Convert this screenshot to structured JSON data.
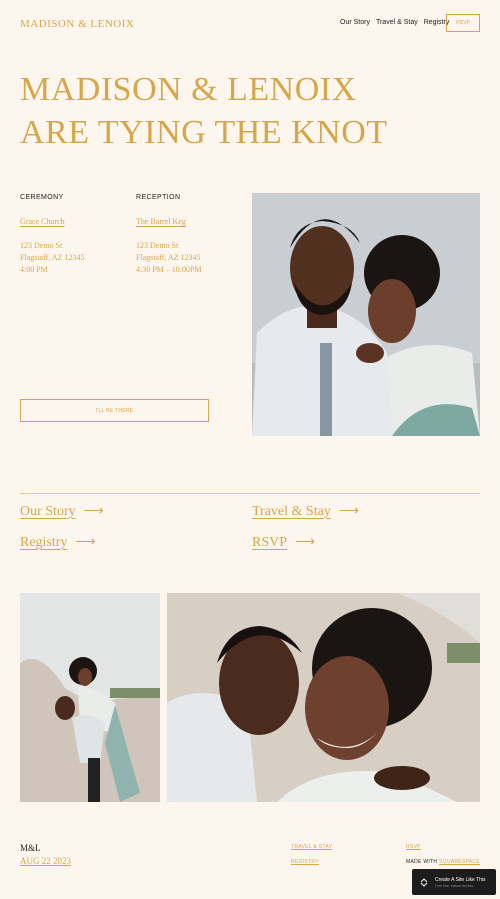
{
  "header": {
    "brand": "MADISON & LENOIX",
    "nav": [
      "Our Story",
      "Travel & Stay",
      "Registry"
    ],
    "rsvp_button": "RSVP"
  },
  "hero": {
    "line1": "MADISON & LENOIX",
    "line2": "ARE TYING THE KNOT"
  },
  "ceremony": {
    "label": "CEREMONY",
    "venue": "Grace Church",
    "address1": "123 Demo St",
    "address2": "Flagstaff, AZ 12345",
    "time": "4:00 PM"
  },
  "reception": {
    "label": "RECEPTION",
    "venue": "The Barrel Keg",
    "address1": "123 Demo St",
    "address2": "Flagstaff, AZ 12345",
    "time": "4:30 PM – 10:00PM"
  },
  "attend_button": "I'LL BE THERE",
  "links": [
    "Our Story",
    "Travel & Stay",
    "Registry",
    "RSVP"
  ],
  "arrow": "⟶",
  "footer": {
    "initials": "M&L",
    "date": "AUG 22 2023",
    "travel": "TRAVEL & STAY",
    "registry": "REGISTRY",
    "rsvp": "RSVP",
    "made_with": "MADE WITH",
    "squarespace": "SQUARESPACE"
  },
  "badge": {
    "title": "Create A Site Like This",
    "subtitle": "Free trial. Instant access."
  },
  "colors": {
    "background": "#fdf6ef",
    "accent": "#d6a74a"
  }
}
